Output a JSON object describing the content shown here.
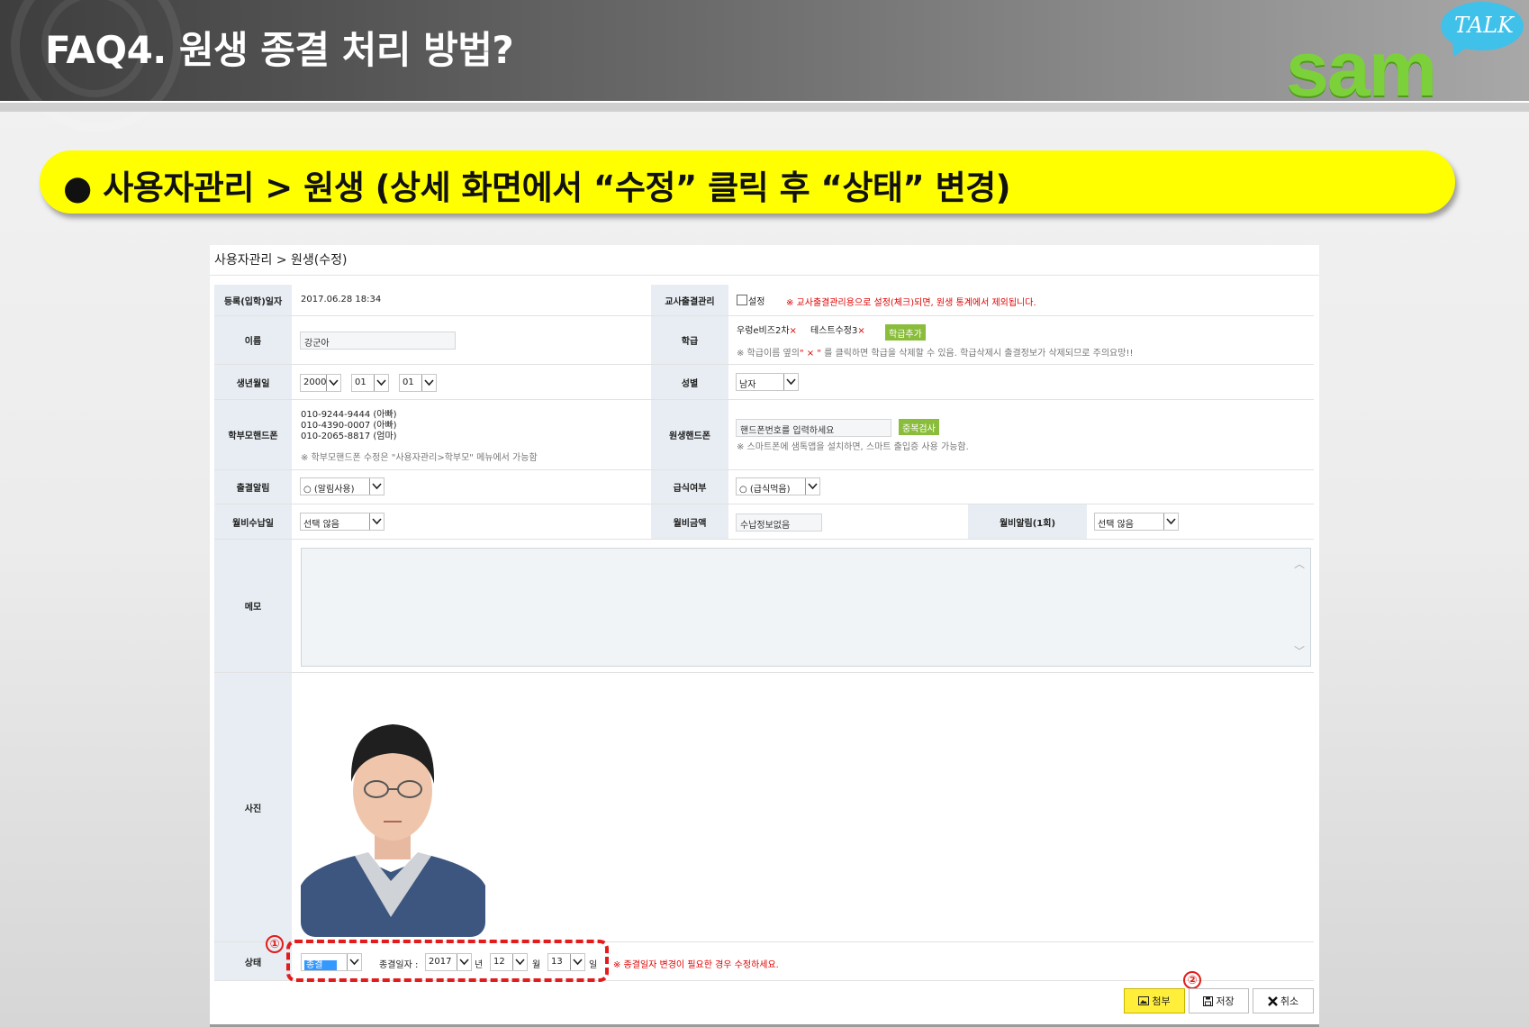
{
  "header": {
    "title": "FAQ4. 원생 종결 처리 방법?",
    "logo_word": "sam",
    "logo_badge": "TALK"
  },
  "banner": {
    "bullet": "●",
    "text": "사용자관리 > 원생 (상세 화면에서 “수정” 클릭 후 “상태” 변경)"
  },
  "form": {
    "breadcrumb": "사용자관리 > 원생(수정)",
    "reg_date": {
      "label": "등록(입학)일자",
      "value": "2017.06.28 18:34"
    },
    "attendance_mgmt": {
      "label": "교사출결관리",
      "checkbox_label": "설정",
      "note": "※ 교사출결관리용으로 설정(체크)되면, 원생 통계에서 제외됩니다."
    },
    "name": {
      "label": "이름",
      "value": "강군아"
    },
    "class": {
      "label": "학급",
      "tag1": "우렁e비즈2차",
      "tag2": "테스트수정3",
      "remove": "×",
      "add_button": "학급추가",
      "note_a": "※ 학급이름 옆의",
      "note_x": "\" × \"",
      "note_b": "를 클릭하면 학급을 삭제할 수 있음. 학급삭제시 출결정보가 삭제되므로 주의요망!!"
    },
    "birth": {
      "label": "생년월일",
      "year": "2000",
      "month": "01",
      "day": "01"
    },
    "gender": {
      "label": "성별",
      "value": "남자"
    },
    "parent_phone": {
      "label": "학부모핸드폰",
      "lines": [
        "010-9244-9444 (아빠)",
        "010-4390-0007 (아빠)",
        "010-2065-8817 (엄마)"
      ],
      "note": "※ 학부모핸드폰 수정은 \"사용자관리>학부모\" 메뉴에서 가능함"
    },
    "student_phone": {
      "label": "원생핸드폰",
      "placeholder": "핸드폰번호를 입력하세요",
      "dup_button": "중복검사",
      "note": "※ 스마트폰에 샘톡앱을 설치하면, 스마트 출입증 사용 가능함."
    },
    "attendance_alarm": {
      "label": "출결알림",
      "value": "○ (알림사용)"
    },
    "meal": {
      "label": "급식여부",
      "value": "○ (급식먹음)"
    },
    "fee_day": {
      "label": "월비수납일",
      "value": "선택 않음"
    },
    "fee_amount": {
      "label": "월비금액",
      "placeholder": "수납정보없음"
    },
    "fee_alarm": {
      "label": "월비알림(1회)",
      "value": "선택 않음"
    },
    "memo": {
      "label": "메모"
    },
    "photo": {
      "label": "사진"
    },
    "status": {
      "label": "상태",
      "value": "종결",
      "end_date_label": "종결일자 :",
      "year": "2017",
      "year_unit": "년",
      "month": "12",
      "month_unit": "월",
      "day": "13",
      "day_unit": "일",
      "note": "※ 종결일자 변경이 필요한 경우 수정하세요."
    },
    "buttons": {
      "attach": "첨부",
      "save": "저장",
      "cancel": "취소"
    },
    "markers": {
      "one": "①",
      "two": "②"
    }
  },
  "colors": {
    "banner": "#ffff00",
    "label_bg": "#e7edf2",
    "annotation": "#e21c1c",
    "green_button": "#8bbd3c",
    "logo": "#7cd13a"
  }
}
